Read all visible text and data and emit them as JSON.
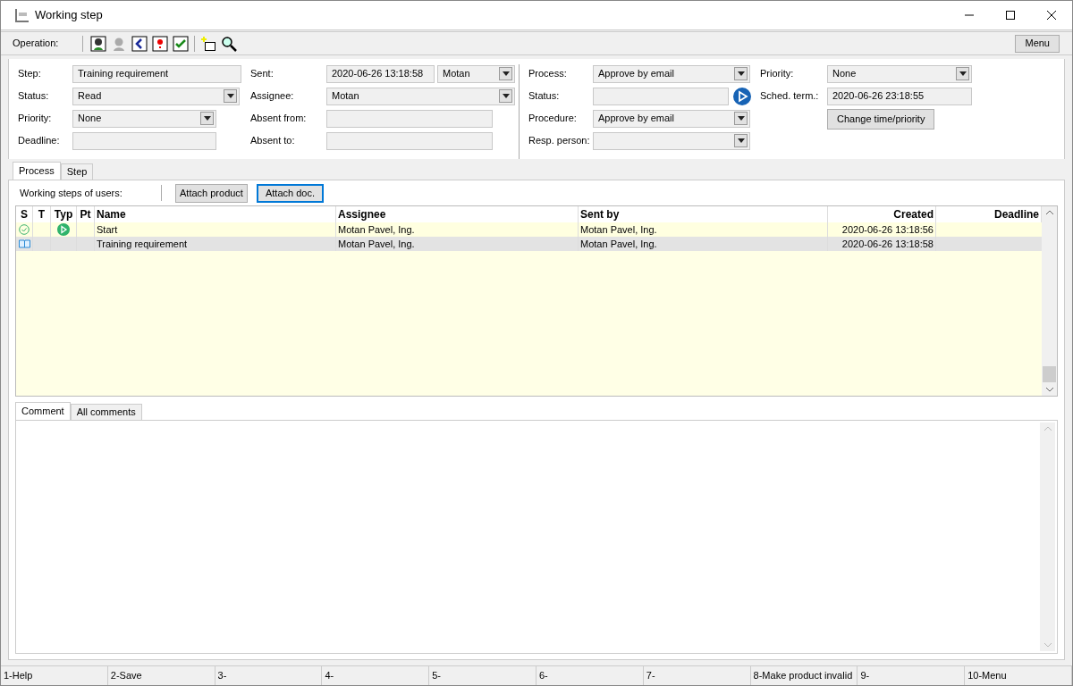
{
  "window": {
    "title": "Working step"
  },
  "toolbar": {
    "label": "Operation:",
    "menu": "Menu"
  },
  "form_columns": [
    [
      {
        "label": "Step:",
        "kind": "text",
        "value": "Training requirement"
      },
      {
        "label": "Status:",
        "kind": "select",
        "value": "Read"
      },
      {
        "label": "Priority:",
        "kind": "select",
        "value": "None"
      },
      {
        "label": "Deadline:",
        "kind": "text"
      }
    ],
    [
      {
        "label": "Sent:",
        "kind": "text_select",
        "value": "2020-06-26 13:18:58",
        "value2": "Motan"
      },
      {
        "label": "Assignee:",
        "kind": "select",
        "value": "Motan"
      },
      {
        "label": "Absent from:",
        "kind": "text"
      },
      {
        "label": "Absent to:",
        "kind": "text"
      }
    ],
    [
      {
        "label": "Process:",
        "kind": "select",
        "value": "Approve by email"
      },
      {
        "label": "Status:",
        "kind": "text_play"
      },
      {
        "label": "Procedure:",
        "kind": "select",
        "value": "Approve by email"
      },
      {
        "label": "Resp. person:",
        "kind": "select"
      }
    ],
    [
      {
        "label": "Priority:",
        "kind": "select",
        "value": "None"
      },
      {
        "label": "Sched. term.:",
        "kind": "text",
        "value": "2020-06-26 23:18:55"
      },
      {
        "label": "Change time/priority",
        "kind": "button"
      }
    ]
  ],
  "tabs": [
    {
      "label": "Process",
      "selected": true
    },
    {
      "label": "Step",
      "selected": false
    }
  ],
  "steps_bar": {
    "label": "Working steps of users:",
    "buttons": [
      {
        "label": "Attach product",
        "focused": false
      },
      {
        "label": "Attach doc.",
        "focused": true
      }
    ]
  },
  "table": {
    "columns": [
      "S",
      "T",
      "Typ",
      "Pt",
      "Name",
      "Assignee",
      "Sent by",
      "Created",
      "Deadline"
    ],
    "rows": [
      {
        "status_icon": {
          "kind": "done"
        },
        "type_icon": {
          "kind": "start"
        },
        "name": "Start",
        "assignee": "Motan Pavel, Ing.",
        "sent_by": "Motan Pavel, Ing.",
        "created": "2020-06-26 13:18:56",
        "selected": false
      },
      {
        "status_icon": {
          "kind": "read"
        },
        "name": "Training requirement",
        "assignee": "Motan Pavel, Ing.",
        "sent_by": "Motan Pavel, Ing.",
        "created": "2020-06-26 13:18:58",
        "selected": true
      }
    ]
  },
  "comment_tabs": [
    {
      "label": "Comment",
      "selected": true
    },
    {
      "label": "All comments",
      "selected": false
    }
  ],
  "function_keys": [
    "1-Help",
    "2-Save",
    "3-",
    "4-",
    "5-",
    "6-",
    "7-",
    "8-Make product invalid",
    "9-",
    "10-Menu"
  ]
}
